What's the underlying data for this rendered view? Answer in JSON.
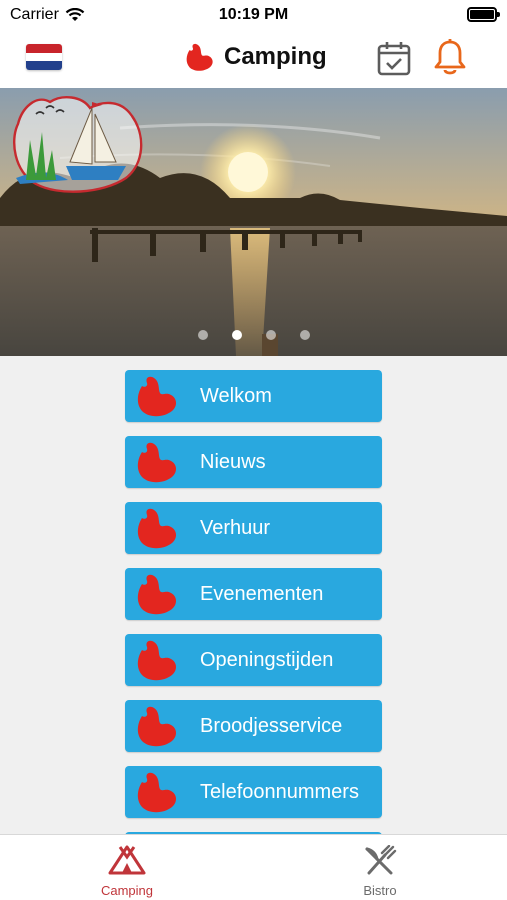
{
  "status_bar": {
    "carrier": "Carrier",
    "time": "10:19 PM"
  },
  "nav": {
    "title": "Camping",
    "language_flag": "dutch-flag-icon",
    "actions": [
      "calendar-check-icon",
      "bell-icon"
    ]
  },
  "colors": {
    "brand_red": "#e3261f",
    "menu_blue": "#29a8df",
    "bell_orange": "#e8671b",
    "active_tab": "#c0353a",
    "inactive_tab": "#6b6b6b"
  },
  "carousel": {
    "slide_count": 4,
    "active_index": 1
  },
  "menu": {
    "items": [
      {
        "label": "Welkom"
      },
      {
        "label": "Nieuws"
      },
      {
        "label": "Verhuur"
      },
      {
        "label": "Evenementen"
      },
      {
        "label": "Openingstijden"
      },
      {
        "label": "Broodjesservice"
      },
      {
        "label": "Telefoonnummers"
      }
    ]
  },
  "tabs": {
    "camping": {
      "label": "Camping",
      "icon": "tent-icon",
      "active": true
    },
    "bistro": {
      "label": "Bistro",
      "icon": "fork-knife-icon",
      "active": false
    }
  }
}
